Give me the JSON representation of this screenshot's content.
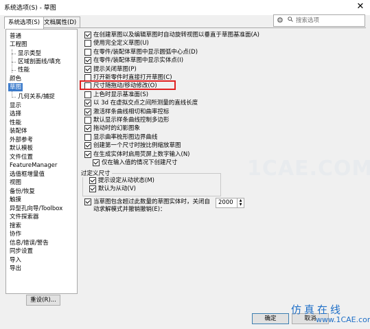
{
  "window": {
    "title": "系统选项(S) - 草图"
  },
  "tabs": [
    "系统选项(S)",
    "文档属性(D)"
  ],
  "search": {
    "placeholder": "搜索选项"
  },
  "nav": {
    "items": [
      "普通",
      "工程图",
      "显示类型",
      "区域剖面线/填充",
      "性能",
      "颜色",
      "草图",
      "几何关系/捕捉",
      "显示",
      "选择",
      "性能",
      "装配体",
      "外部参考",
      "默认模板",
      "文件位置",
      "FeatureManager",
      "选值框增量值",
      "视图",
      "备份/恢复",
      "触摸",
      "异型孔向导/Toolbox",
      "文件探索器",
      "搜索",
      "协作",
      "信息/错误/警告",
      "同步设置",
      "导入",
      "导出"
    ],
    "selected_index": 6
  },
  "options": [
    {
      "label": "在创建草图以及编辑草图时自动旋转视图以垂直于草图基准面(A)",
      "checked": true
    },
    {
      "label": "使用完全定义草图(U)",
      "checked": false
    },
    {
      "label": "在零件/装配体草图中显示圆弧中心点(D)",
      "checked": false
    },
    {
      "label": "在零件/装配体草图中显示实体点(I)",
      "checked": true
    },
    {
      "label": "提示关闭草图(P)",
      "checked": true
    },
    {
      "label": "打开新零件时直接打开草图(C)",
      "checked": false
    },
    {
      "label": "尺寸随拖动/移动修改(O)",
      "checked": false
    },
    {
      "label": "上色时显示基准面(S)",
      "checked": false
    },
    {
      "label": "以 3d 在虚拟交点之间所测量的直线长度",
      "checked": true
    },
    {
      "label": "激活样条曲线相切和曲率控标",
      "checked": true
    },
    {
      "label": "默认显示样条曲线控制多边形",
      "checked": false
    },
    {
      "label": "拖动时的幻影图象",
      "checked": true
    },
    {
      "label": "显示曲率梳形图边界曲线",
      "checked": false
    },
    {
      "label": "创建第一个尺寸时按比例缩放草图",
      "checked": true
    },
    {
      "label": "在生成实体时启用荧屏上数字输入(N)",
      "checked": true
    },
    {
      "label": "仅在输入值的情况下创建尺寸",
      "checked": true
    }
  ],
  "overdefined": {
    "title": "过定义尺寸",
    "options": [
      {
        "label": "提示设定从动状态(M)",
        "checked": true
      },
      {
        "label": "默认为从动(V)",
        "checked": true
      }
    ]
  },
  "limit": {
    "line1": "当草图包含超过此数量的草图实体时，关闭自",
    "line2": "动求解模式并撤销撤销(E)：",
    "checked": true,
    "value": "2000"
  },
  "buttons": {
    "reset": "重设(R)...",
    "ok": "确定",
    "cancel": "取消"
  },
  "watermark": {
    "center": "1CAE.COM",
    "brand_cn": "仿真在线",
    "brand_url": "www.1CAE.com"
  },
  "colors": {
    "nav_selected": "#3b7bcb",
    "highlight_border": "#e02020",
    "brand": "#1f6fc7"
  }
}
